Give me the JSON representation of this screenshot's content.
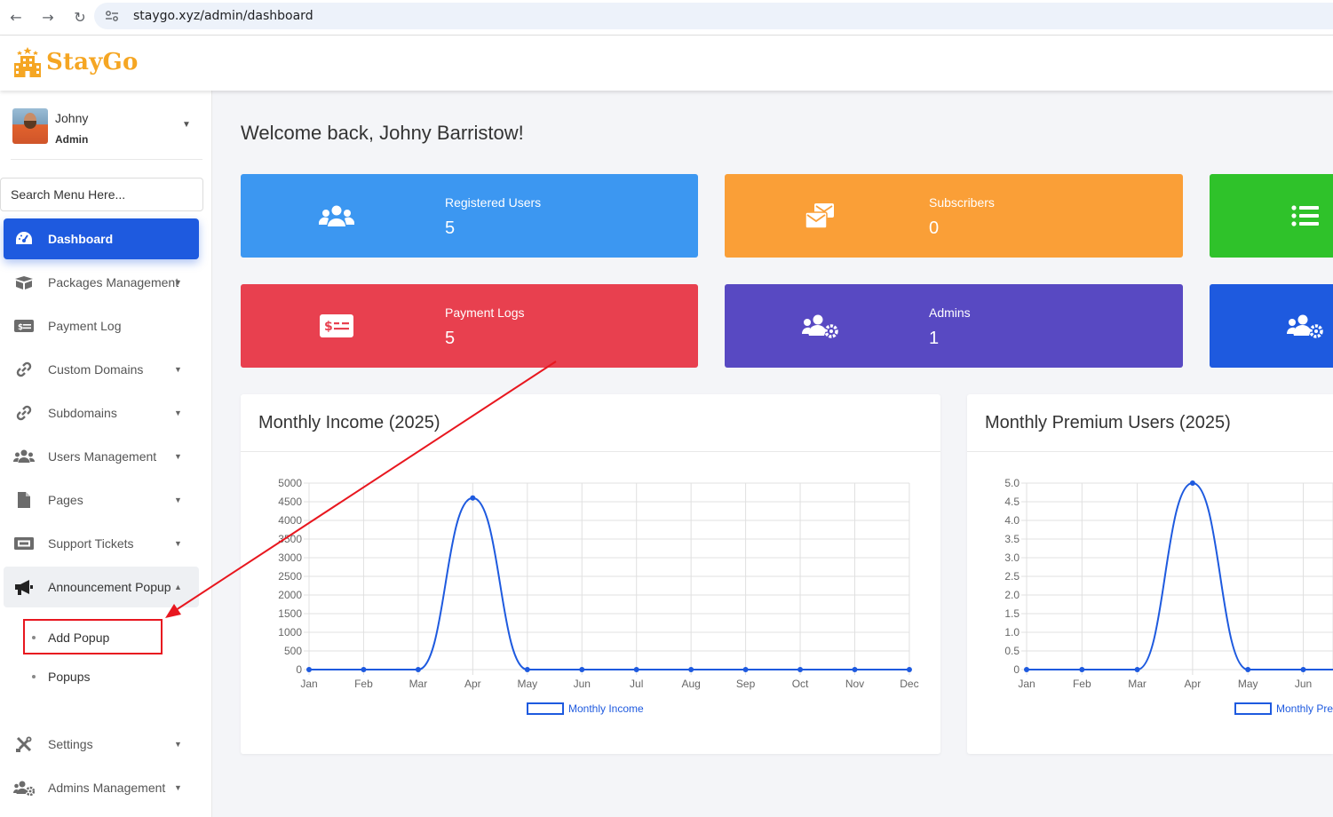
{
  "browser": {
    "url": "staygo.xyz/admin/dashboard"
  },
  "brand": {
    "name": "StayGo",
    "color": "#f5a623"
  },
  "user": {
    "name": "Johny",
    "role": "Admin"
  },
  "sidebar": {
    "search_placeholder": "Search Menu Here...",
    "items": [
      {
        "label": "Dashboard",
        "icon": "dashboard-icon",
        "active": true
      },
      {
        "label": "Packages Management",
        "icon": "box-icon",
        "caret": true
      },
      {
        "label": "Payment Log",
        "icon": "money-icon"
      },
      {
        "label": "Custom Domains",
        "icon": "link-icon",
        "caret": true
      },
      {
        "label": "Subdomains",
        "icon": "link-icon",
        "caret": true
      },
      {
        "label": "Users Management",
        "icon": "users-icon",
        "caret": true
      },
      {
        "label": "Pages",
        "icon": "file-icon",
        "caret": true
      },
      {
        "label": "Support Tickets",
        "icon": "ticket-icon",
        "caret": true
      },
      {
        "label": "Announcement Popup",
        "icon": "megaphone-icon",
        "open": true
      },
      {
        "label": "Settings",
        "icon": "tools-icon",
        "caret": true
      },
      {
        "label": "Admins Management",
        "icon": "users-cog-icon",
        "caret": true
      }
    ],
    "sub_items": [
      "Add Popup",
      "Popups"
    ]
  },
  "welcome": "Welcome back, Johny Barristow!",
  "stats": [
    {
      "label": "Registered Users",
      "value": "5",
      "color": "#3c97f1",
      "icon": "users-icon"
    },
    {
      "label": "Subscribers",
      "value": "0",
      "color": "#fa9f37",
      "icon": "envelopes-icon"
    },
    {
      "label": "",
      "value": "",
      "color": "#2fc22a",
      "icon": "list-icon"
    },
    {
      "label": "Payment Logs",
      "value": "5",
      "color": "#e8404f",
      "icon": "money-check-icon"
    },
    {
      "label": "Admins",
      "value": "1",
      "color": "#5849c2",
      "icon": "users-cog-icon"
    },
    {
      "label": "",
      "value": "",
      "color": "#1e5adf",
      "icon": "users-cog-icon"
    }
  ],
  "chart_data": [
    {
      "type": "line",
      "title": "Monthly Income (2025)",
      "x": [
        "Jan",
        "Feb",
        "Mar",
        "Apr",
        "May",
        "Jun",
        "Jul",
        "Aug",
        "Sep",
        "Oct",
        "Nov",
        "Dec"
      ],
      "series": [
        {
          "name": "Monthly Income",
          "values": [
            0,
            0,
            0,
            4600,
            0,
            0,
            0,
            0,
            0,
            0,
            0,
            0
          ]
        }
      ],
      "ylim": [
        0,
        5000
      ],
      "yticks": [
        "0",
        "500",
        "1000",
        "1500",
        "2000",
        "2500",
        "3000",
        "3500",
        "4000",
        "4500",
        "5000"
      ],
      "grid": true,
      "legend": "bottom",
      "color": "#1e5adf"
    },
    {
      "type": "line",
      "title": "Monthly Premium Users (2025)",
      "x": [
        "Jan",
        "Feb",
        "Mar",
        "Apr",
        "May",
        "Jun"
      ],
      "series": [
        {
          "name": "Monthly Pre",
          "values": [
            0,
            0,
            0,
            5,
            0,
            0
          ]
        }
      ],
      "ylim": [
        0,
        5
      ],
      "yticks": [
        "0",
        "0.5",
        "1.0",
        "1.5",
        "2.0",
        "2.5",
        "3.0",
        "3.5",
        "4.0",
        "4.5",
        "5.0"
      ],
      "grid": true,
      "legend": "bottom",
      "color": "#1e5adf"
    }
  ]
}
